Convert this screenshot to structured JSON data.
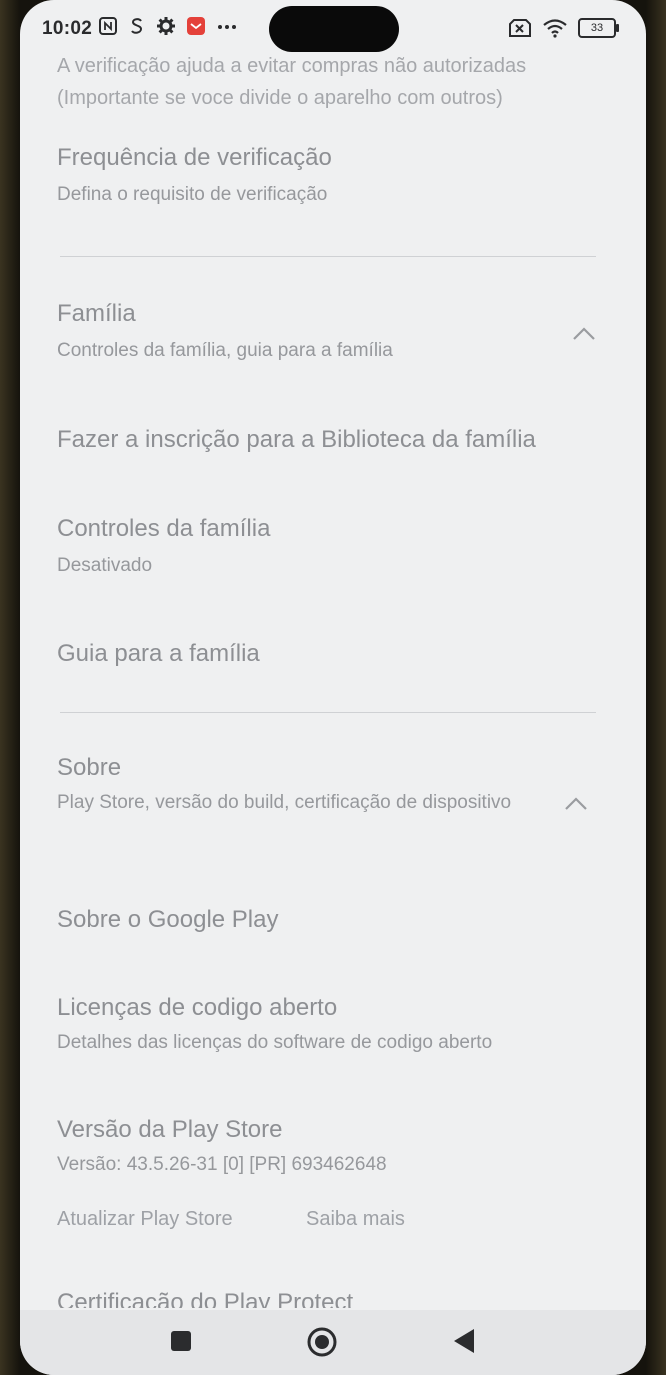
{
  "status_bar": {
    "time": "10:02",
    "left_icons": [
      "nfc-icon",
      "s-icon",
      "gear-icon",
      "notification-app-icon",
      "more-dots-icon"
    ],
    "battery_level": "33"
  },
  "intro_text": "A verificação ajuda a evitar compras não autorizadas (Importante se voce divide o aparelho com outros)",
  "verification": {
    "title": "Frequência de verificação",
    "subtitle": "Defina o requisito de verificação"
  },
  "family_section": {
    "title": "Família",
    "subtitle": "Controles da família, guia para a família",
    "items": [
      {
        "title": "Fazer a inscrição para a Biblioteca da família"
      },
      {
        "title": "Controles da família",
        "subtitle": "Desativado"
      },
      {
        "title": "Guia para a família"
      }
    ]
  },
  "about_section": {
    "title": "Sobre",
    "subtitle": "Play Store, versão do build, certificação de dispositivo",
    "items": [
      {
        "title": "Sobre o Google Play"
      },
      {
        "title": "Licenças de codigo aberto",
        "subtitle": "Detalhes das licenças do software de codigo aberto"
      },
      {
        "title": "Versão da Play Store",
        "subtitle": "Versão: 43.5.26-31 [0] [PR] 693462648"
      }
    ],
    "update_link": "Atualizar Play Store",
    "learn_more_link": "Saiba mais",
    "cut_off_item": "Certificação do Play Protect"
  },
  "nav_bar": {
    "buttons": [
      "recents-square-icon",
      "home-circle-icon",
      "back-triangle-icon"
    ]
  }
}
